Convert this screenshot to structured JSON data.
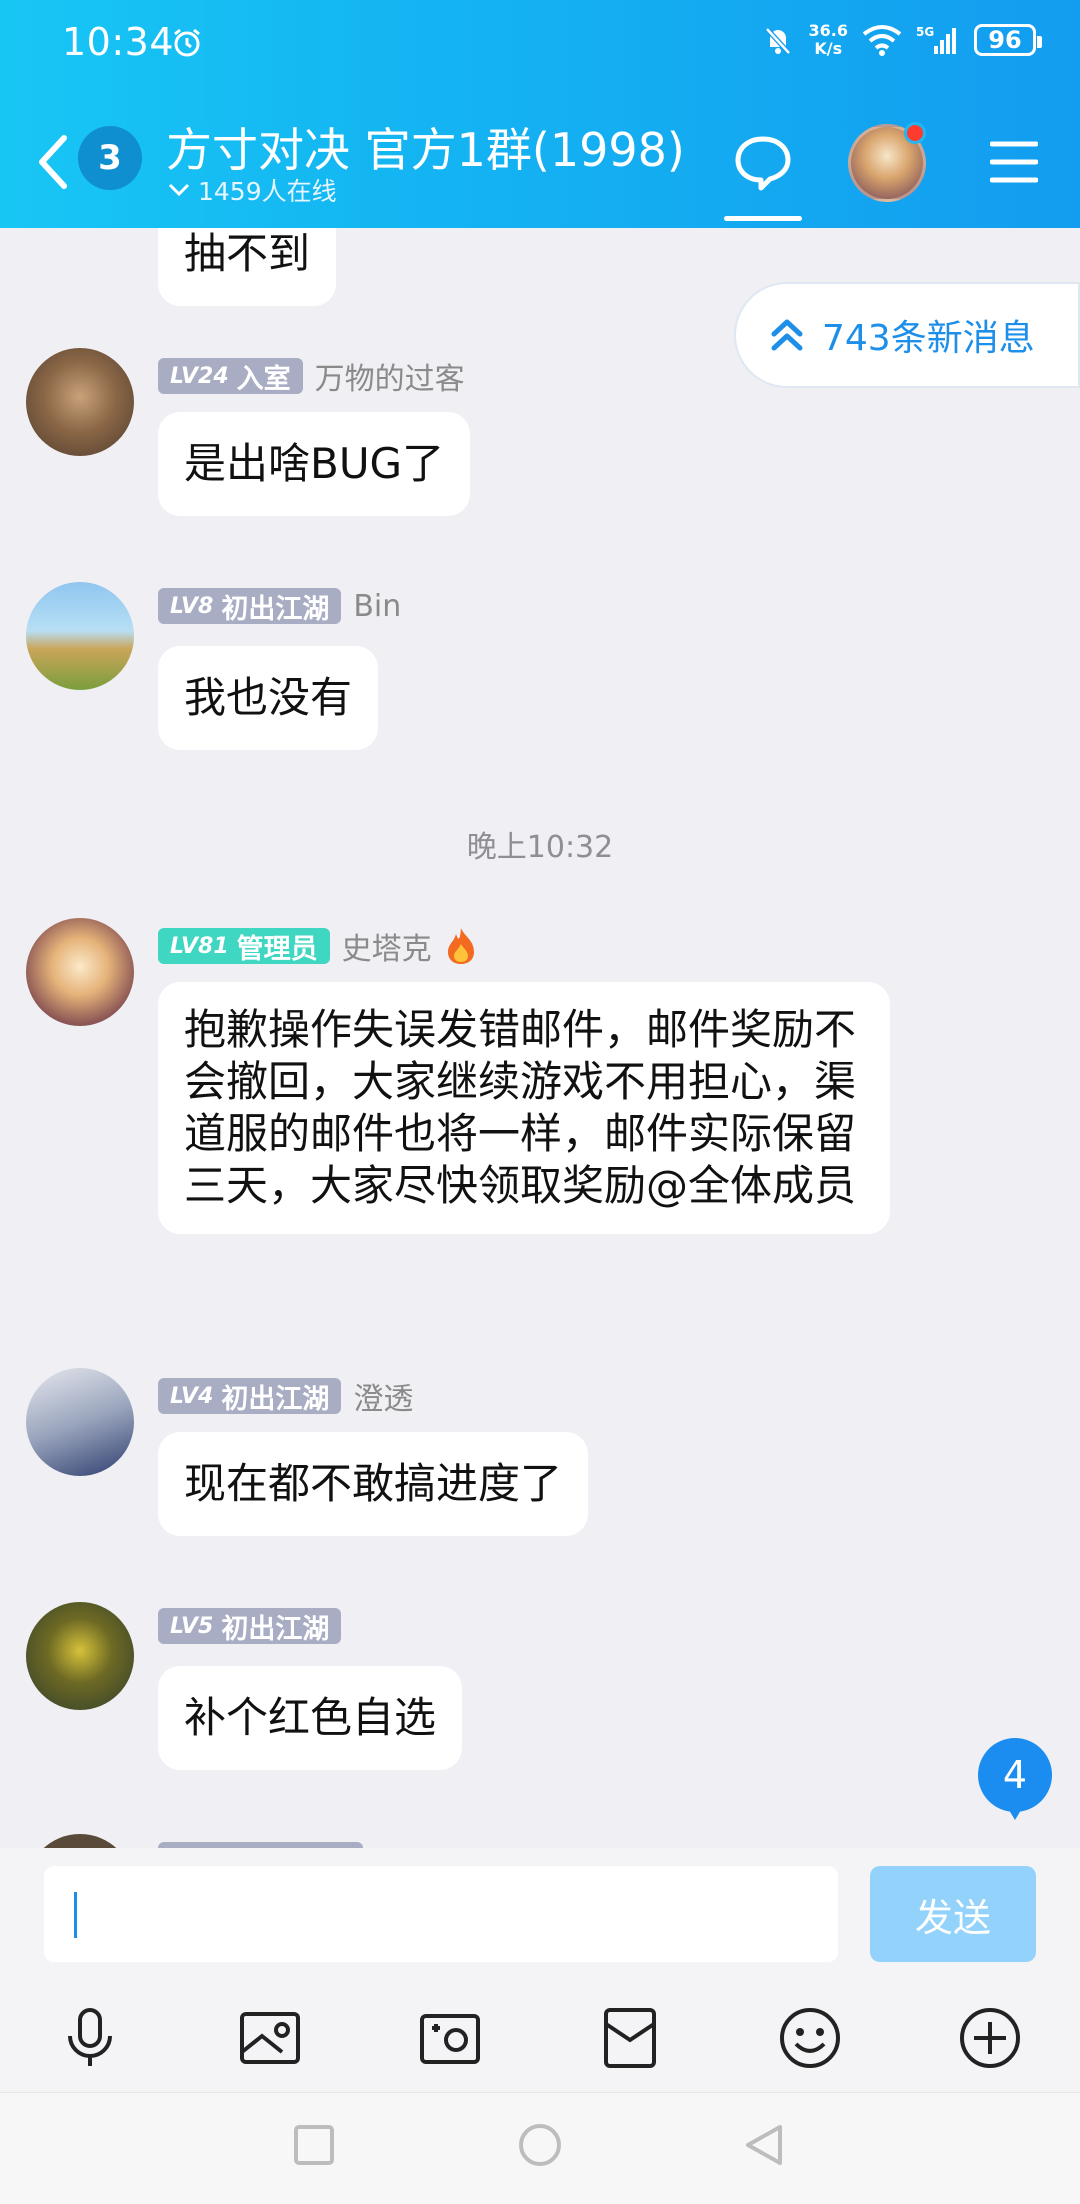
{
  "status": {
    "time": "10:34",
    "net_speed_top": "36.6",
    "net_speed_bottom": "K/s",
    "battery": "96"
  },
  "header": {
    "unread_count": "3",
    "title": "方寸对决 官方1群(1998)",
    "online": "1459人在线"
  },
  "new_messages_label": "743条新消息",
  "messages": [
    {
      "text": "抽不到"
    },
    {
      "level": "LV24",
      "title": "入室",
      "name": "万物的过客",
      "text": "是出啥BUG了"
    },
    {
      "level": "LV8",
      "title": "初出江湖",
      "name": "Bin",
      "text": "我也没有"
    },
    {
      "timestamp": "晚上10:32"
    },
    {
      "level": "LV81",
      "title": "管理员",
      "name": "史塔克",
      "text": "抱歉操作失误发错邮件，邮件奖励不会撤回，大家继续游戏不用担心，渠道服的邮件也将一样，邮件实际保留三天，大家尽快领取奖励@全体成员"
    },
    {
      "level": "LV4",
      "title": "初出江湖",
      "name": "澄透",
      "text": "现在都不敢搞进度了"
    },
    {
      "level": "LV5",
      "title": "初出江湖",
      "name": "",
      "text": "补个红色自选"
    }
  ],
  "float_count": "4",
  "input": {
    "placeholder": "",
    "send_label": "发送"
  },
  "colors": {
    "header_gradient_start": "#18c6f4",
    "header_gradient_end": "#139df0",
    "admin_badge": "#3fd6c2",
    "level_badge": "#a9adc4",
    "send_button": "#93d2fa",
    "link_blue": "#1e8fe8"
  },
  "toolbar_icons": [
    "microphone-icon",
    "image-icon",
    "camera-icon",
    "red-packet-icon",
    "emoji-icon",
    "plus-icon"
  ]
}
